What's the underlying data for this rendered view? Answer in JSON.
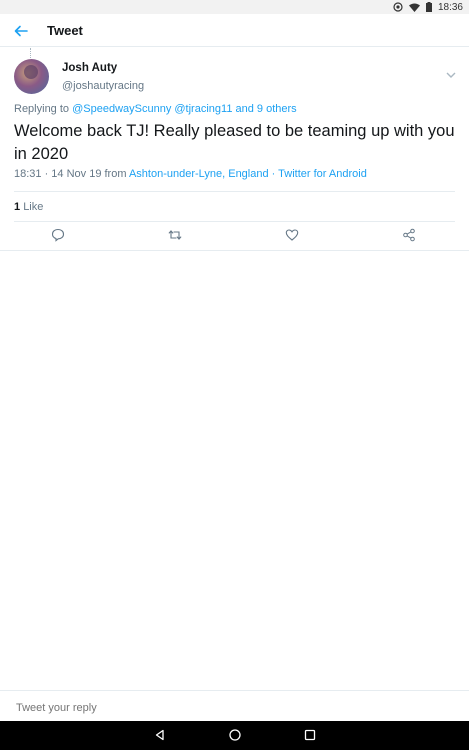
{
  "status": {
    "time": "18:36"
  },
  "header": {
    "title": "Tweet"
  },
  "tweet": {
    "author_name": "Josh Auty",
    "author_handle": "@joshautyracing",
    "replying_prefix": "Replying to",
    "replying_to": "@SpeedwayScunny @tjracing11 and 9 others",
    "text": "Welcome back TJ! Really pleased to be teaming up with you in 2020",
    "time_date": "18:31 · 14 Nov 19 from",
    "location": "Ashton-under-Lyne, England · Twitter for Android",
    "like_count": "1",
    "like_label": "Like"
  },
  "actions": [
    "reply-icon",
    "retweet-icon",
    "like-icon",
    "share-icon"
  ],
  "reply": {
    "placeholder": "Tweet your reply"
  },
  "colors": {
    "accent": "#1da1f2",
    "secondary_text": "#657786",
    "divider": "#e6ecf0"
  }
}
